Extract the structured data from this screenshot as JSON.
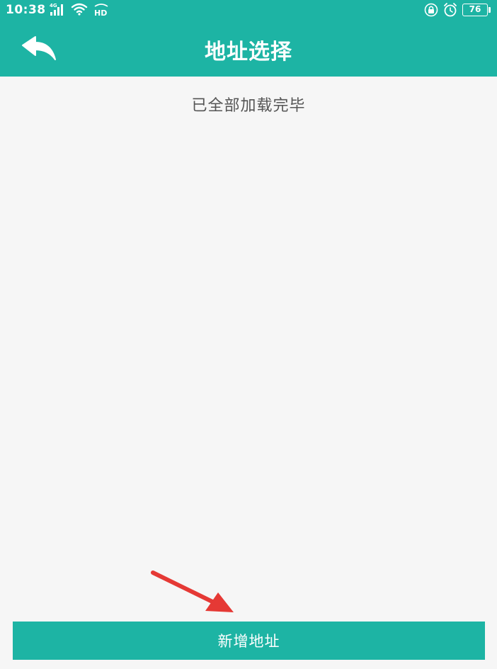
{
  "status_bar": {
    "time": "10:38",
    "signal_label": "4G",
    "hd_label": "HD",
    "battery_level": "76",
    "icons": [
      "signal-icon",
      "wifi-icon",
      "hd-icon",
      "lock-icon",
      "alarm-icon",
      "battery-icon"
    ]
  },
  "header": {
    "title": "地址选择",
    "back_icon": "back-arrow-icon"
  },
  "content": {
    "load_status": "已全部加载完毕"
  },
  "footer": {
    "add_button_label": "新增地址"
  },
  "colors": {
    "accent": "#1db4a4",
    "background": "#f6f6f6",
    "annotation": "#e53935"
  }
}
